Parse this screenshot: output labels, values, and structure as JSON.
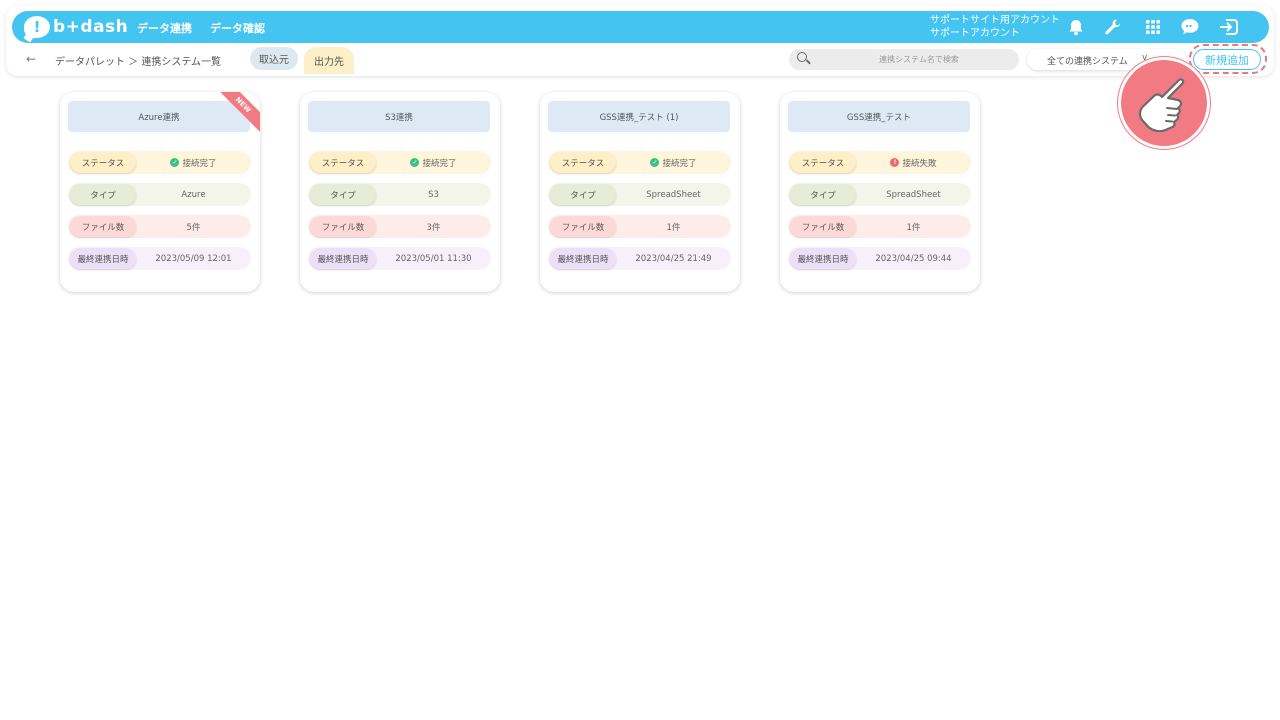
{
  "header": {
    "logo_mark": "!",
    "logo_text": "b+dash",
    "nav": [
      "データ連携",
      "データ確認"
    ],
    "account_line1": "サポートサイト用アカウント",
    "account_line2": "サポートアカウント",
    "icons": [
      "bell-icon",
      "wrench-icon",
      "grid-icon",
      "chat-icon",
      "logout-icon"
    ]
  },
  "subbar": {
    "back_glyph": "←",
    "breadcrumb": "データパレット ＞ 連携システム一覧",
    "tabs": {
      "in_label": "取込元",
      "out_label": "出力先"
    },
    "search_placeholder": "連携システム名で検索",
    "filter_value": "全ての連携システム",
    "filter_chevron": "v",
    "add_label": "新規追加"
  },
  "colors": {
    "primary": "#43c4f1",
    "accent": "#f27b83",
    "ok": "#3bbf8a",
    "err": "#ef6a6a"
  },
  "card_labels": {
    "status": "ステータス",
    "type": "タイプ",
    "files": "ファイル数",
    "last": "最終連携日時"
  },
  "cards": [
    {
      "title": "Azure連携",
      "badge": "NEW",
      "status": "接続完了",
      "status_ok": true,
      "type": "Azure",
      "files": "5件",
      "last": "2023/05/09 12:01"
    },
    {
      "title": "S3連携",
      "badge": "",
      "status": "接続完了",
      "status_ok": true,
      "type": "S3",
      "files": "3件",
      "last": "2023/05/01 11:30"
    },
    {
      "title": "GSS連携_テスト (1)",
      "badge": "",
      "status": "接続完了",
      "status_ok": true,
      "type": "SpreadSheet",
      "files": "1件",
      "last": "2023/04/25 21:49"
    },
    {
      "title": "GSS連携_テスト",
      "badge": "",
      "status": "接続失敗",
      "status_ok": false,
      "type": "SpreadSheet",
      "files": "1件",
      "last": "2023/04/25 09:44"
    }
  ]
}
